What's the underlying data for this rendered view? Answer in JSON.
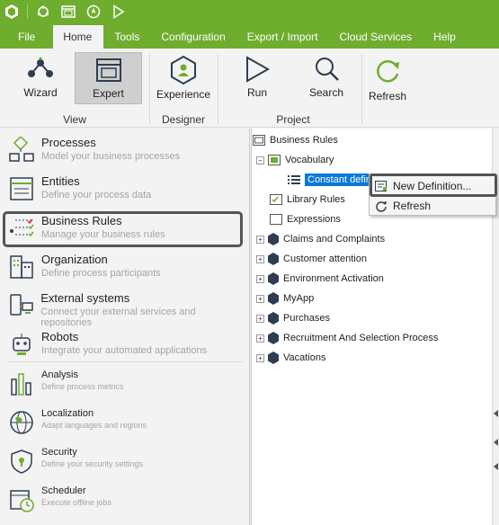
{
  "titlebar": {
    "icons": [
      "app-logo-icon",
      "sync-icon",
      "window-icon",
      "compass-icon",
      "play-icon"
    ]
  },
  "menu": {
    "items": [
      "File",
      "Home",
      "Tools",
      "Configuration",
      "Export / Import",
      "Cloud Services",
      "Help"
    ],
    "active": "Home"
  },
  "ribbon": {
    "buttons": {
      "wizard": "Wizard",
      "expert": "Expert",
      "experience": "Experience",
      "run": "Run",
      "search": "Search",
      "refresh": "Refresh"
    },
    "groups": {
      "view": "View",
      "designer": "Designer",
      "project": "Project"
    }
  },
  "left": {
    "items": [
      {
        "title": "Processes",
        "subtitle": "Model your business processes"
      },
      {
        "title": "Entities",
        "subtitle": "Define your process data"
      },
      {
        "title": "Business Rules",
        "subtitle": "Manage your business rules"
      },
      {
        "title": "Organization",
        "subtitle": "Define process participants"
      },
      {
        "title": "External systems",
        "subtitle": "Connect your external services and repositories"
      },
      {
        "title": "Robots",
        "subtitle": "Integrate your automated applications"
      },
      {
        "title": "Analysis",
        "subtitle": "Define process metrics"
      },
      {
        "title": "Localization",
        "subtitle": "Adapt languages and regions"
      },
      {
        "title": "Security",
        "subtitle": "Define your security settings"
      },
      {
        "title": "Scheduler",
        "subtitle": "Execute offline jobs"
      }
    ]
  },
  "tree": {
    "root": "Business Rules",
    "vocabulary": "Vocabulary",
    "selected": "Constant defin",
    "library_rules": "Library Rules",
    "expressions": "Expressions",
    "apps": [
      "Claims and Complaints",
      "Customer attention",
      "Environment Activation",
      "MyApp",
      "Purchases",
      "Recruitment And Selection Process",
      "Vacations"
    ]
  },
  "context_menu": {
    "new_definition": "New Definition...",
    "refresh": "Refresh"
  },
  "colors": {
    "brand_green": "#6fad2e",
    "selection_blue": "#0a78d7",
    "app_icon_dark": "#2e3e52"
  }
}
